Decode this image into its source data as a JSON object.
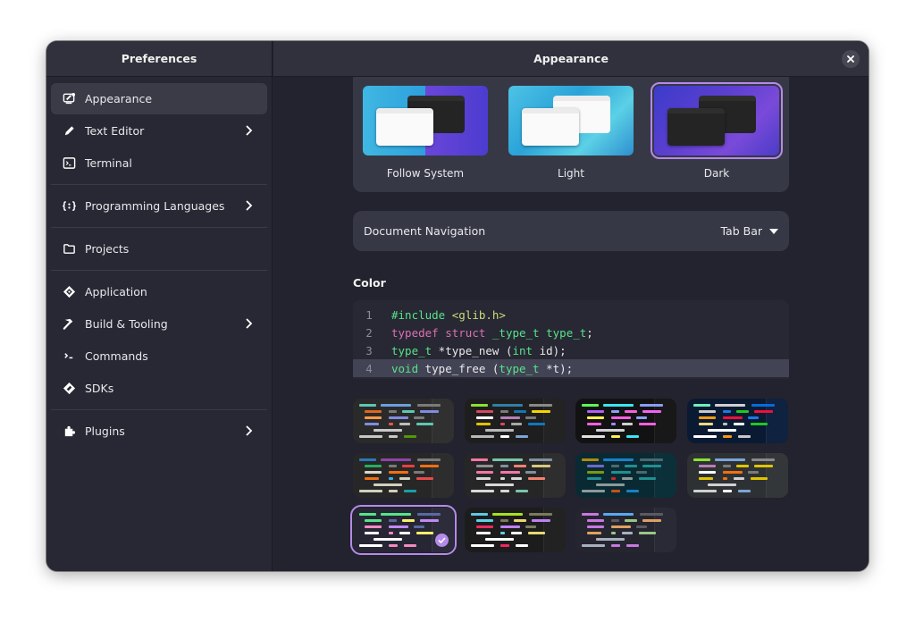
{
  "sidebar": {
    "title": "Preferences",
    "groups": [
      [
        {
          "label": "Appearance",
          "icon": "appearance-icon",
          "active": true,
          "chevron": false
        },
        {
          "label": "Text Editor",
          "icon": "pencil-icon",
          "active": false,
          "chevron": true
        },
        {
          "label": "Terminal",
          "icon": "terminal-icon",
          "active": false,
          "chevron": false
        }
      ],
      [
        {
          "label": "Programming Languages",
          "icon": "braces-icon",
          "active": false,
          "chevron": true
        }
      ],
      [
        {
          "label": "Projects",
          "icon": "folder-icon",
          "active": false,
          "chevron": false
        }
      ],
      [
        {
          "label": "Application",
          "icon": "application-icon",
          "active": false,
          "chevron": false
        },
        {
          "label": "Build & Tooling",
          "icon": "hammer-icon",
          "active": false,
          "chevron": true
        },
        {
          "label": "Commands",
          "icon": "commands-icon",
          "active": false,
          "chevron": false
        },
        {
          "label": "SDKs",
          "icon": "sdk-icon",
          "active": false,
          "chevron": false
        }
      ],
      [
        {
          "label": "Plugins",
          "icon": "puzzle-icon",
          "active": false,
          "chevron": true
        }
      ]
    ]
  },
  "main": {
    "title": "Appearance",
    "close_icon": "close-icon",
    "style_options": [
      {
        "label": "Follow System",
        "selected": false,
        "bg": "split",
        "back": "b",
        "front": "w"
      },
      {
        "label": "Light",
        "selected": false,
        "bg": "light",
        "back": "w",
        "front": "w"
      },
      {
        "label": "Dark",
        "selected": true,
        "bg": "dark",
        "back": "b",
        "front": "b"
      }
    ],
    "document_navigation": {
      "label": "Document Navigation",
      "value": "Tab Bar"
    },
    "color_section_title": "Color",
    "code_preview": [
      {
        "num": "1",
        "current": false,
        "tokens": [
          [
            "#include",
            "pp"
          ],
          [
            " ",
            "tx"
          ],
          [
            "<glib.h>",
            "str"
          ]
        ]
      },
      {
        "num": "2",
        "current": false,
        "tokens": [
          [
            "typedef",
            "kw"
          ],
          [
            " ",
            "tx"
          ],
          [
            "struct",
            "kw"
          ],
          [
            " ",
            "tx"
          ],
          [
            "_type_t",
            "ty"
          ],
          [
            " ",
            "tx"
          ],
          [
            "type_t",
            "ty"
          ],
          [
            ";",
            "tx"
          ]
        ]
      },
      {
        "num": "3",
        "current": false,
        "tokens": [
          [
            "type_t",
            "ty"
          ],
          [
            " *type_new (",
            "tx"
          ],
          [
            "int",
            "ty"
          ],
          [
            " id);",
            "tx"
          ]
        ]
      },
      {
        "num": "4",
        "current": true,
        "tokens": [
          [
            "void",
            "ty"
          ],
          [
            " type_free (",
            "tx"
          ],
          [
            "type_t",
            "ty"
          ],
          [
            " *t);",
            "tx"
          ]
        ]
      }
    ],
    "color_schemes": [
      {
        "bg": "#2a2a2a",
        "gutter": "#303030",
        "selected": false,
        "colors": [
          "#5ec7b2",
          "#6a9fe0",
          "#7a7a7a",
          "#e0661c",
          "#7a7a7a",
          "#5ec7b2",
          "#7f8de0",
          "#ff9a4a",
          "#7f8de0",
          "#7a7a7a",
          "#7f8de0",
          "#e05a48",
          "#bdbdbd",
          "#5ec7b2",
          "#c8c8c8",
          "#c8c8c8",
          "#c8c8c8",
          "#4e9a06"
        ]
      },
      {
        "bg": "#1e1e1e",
        "gutter": "#232323",
        "selected": false,
        "colors": [
          "#8ae234",
          "#2f7fa8",
          "#8a8a8a",
          "#d8485e",
          "#7a7a7a",
          "#1078b8",
          "#f5d400",
          "#ffffff",
          "#b87fb8",
          "#7a7a7a",
          "#e0c400",
          "#d8485e",
          "#a8a8a8",
          "#1078b8",
          "#b8b8b8",
          "#b8b8b8",
          "#ffffff",
          "#7aa6da"
        ]
      },
      {
        "bg": "#121212",
        "gutter": "#181818",
        "selected": false,
        "colors": [
          "#5cf55c",
          "#38e8f5",
          "#8a9cf5",
          "#b060f5",
          "#8aa0ff",
          "#f560e0",
          "#f560f5",
          "#fff050",
          "#f560e0",
          "#8aa0ff",
          "#f560e0",
          "#a08aff",
          "#d0d0d0",
          "#f560e0",
          "#d0d0d0",
          "#e0e0e0",
          "#fff050",
          "#38e8f5"
        ]
      },
      {
        "bg": "#0a1a33",
        "gutter": "#0f223f",
        "selected": false,
        "colors": [
          "#6ef0b8",
          "#d0d0d0",
          "#0a6ad8",
          "#c8c8c8",
          "#1a7ae8",
          "#20c820",
          "#f0103a",
          "#f59a10",
          "#f0103a",
          "#1a7ae8",
          "#f5d880",
          "#c0c0c0",
          "#ffffff",
          "#20c820",
          "#ffffff",
          "#ffffff",
          "#f59a10",
          "#c8c8c8"
        ]
      },
      {
        "bg": "#272727",
        "gutter": "#2d2d2d",
        "selected": false,
        "colors": [
          "#2a7ab8",
          "#8e44ad",
          "#7a7a7a",
          "#27ae60",
          "#7a7a7a",
          "#e84040",
          "#f07010",
          "#d8d8c8",
          "#f07010",
          "#7a7a7a",
          "#f07010",
          "#3ab0e8",
          "#d0d0c0",
          "#e84a4a",
          "#d0d0c0",
          "#d0d0c0",
          "#d0d0c0",
          "#16a0a8"
        ]
      },
      {
        "bg": "#262626",
        "gutter": "#2e2e2e",
        "selected": false,
        "colors": [
          "#f575a8",
          "#79c4b0",
          "#8090a0",
          "#909090",
          "#8090a0",
          "#f58070",
          "#d8c880",
          "#f575a8",
          "#f575a8",
          "#8090a0",
          "#d8d8d8",
          "#d8d8d8",
          "#d8d8d8",
          "#f58070",
          "#d8d8d8",
          "#d8d8d8",
          "#d8d8d8",
          "#79c4b0"
        ]
      },
      {
        "bg": "#0a2a33",
        "gutter": "#0c303a",
        "selected": false,
        "colors": [
          "#b08a10",
          "#1a80c8",
          "#4a6a70",
          "#6a6ac8",
          "#4a6a70",
          "#209090",
          "#209090",
          "#7a9a10",
          "#209090",
          "#4a6a70",
          "#209090",
          "#d02a20",
          "#8a9a9a",
          "#209090",
          "#8a9a9a",
          "#8a9a9a",
          "#c8501a",
          "#1a80c8"
        ]
      },
      {
        "bg": "#2e3133",
        "gutter": "#34373a",
        "selected": false,
        "colors": [
          "#8ae234",
          "#7aa6da",
          "#8a8a8a",
          "#b87fb8",
          "#7a7a7a",
          "#e0c400",
          "#e0c400",
          "#ffffff",
          "#f07010",
          "#7a7a7a",
          "#e0c400",
          "#f07010",
          "#d0d0d0",
          "#e0c400",
          "#d0d0d0",
          "#d0d0d0",
          "#ffffff",
          "#7aa6da"
        ]
      },
      {
        "bg": "#262634",
        "gutter": "#2c2c3b",
        "selected": true,
        "colors": [
          "#57e389",
          "#57e389",
          "#5a6aa0",
          "#57e389",
          "#5a6aa0",
          "#f9f06b",
          "#c08af5",
          "#f58ac0",
          "#c08af5",
          "#5a6aa0",
          "#ffffff",
          "#f58ac0",
          "#ffffff",
          "#f9f06b",
          "#ffffff",
          "#ffffff",
          "#f58ac0",
          "#f58ac0"
        ]
      },
      {
        "bg": "#1c1c1c",
        "gutter": "#222222",
        "selected": false,
        "colors": [
          "#60c8e0",
          "#a8e020",
          "#7a7a60",
          "#60d0e8",
          "#7a7a60",
          "#e8d870",
          "#c080f5",
          "#f02860",
          "#c080f5",
          "#7a7a60",
          "#ffffff",
          "#60d0e8",
          "#ffffff",
          "#e8d870",
          "#ffffff",
          "#ffffff",
          "#f02860",
          "#ffffff"
        ]
      },
      {
        "bg": "#252530",
        "gutter": "#2a2a36",
        "selected": false,
        "colors": [
          "#c878e0",
          "#5aa8f0",
          "#5a5a60",
          "#c878e0",
          "#5a5a60",
          "#98c880",
          "#e0a060",
          "#c878e0",
          "#e0a060",
          "#5a5a60",
          "#e0a060",
          "#98c880",
          "#a8b0c0",
          "#98c880",
          "#a8b0c0",
          "#a8b0c0",
          "#c878e0",
          "#c878e0"
        ]
      }
    ]
  }
}
